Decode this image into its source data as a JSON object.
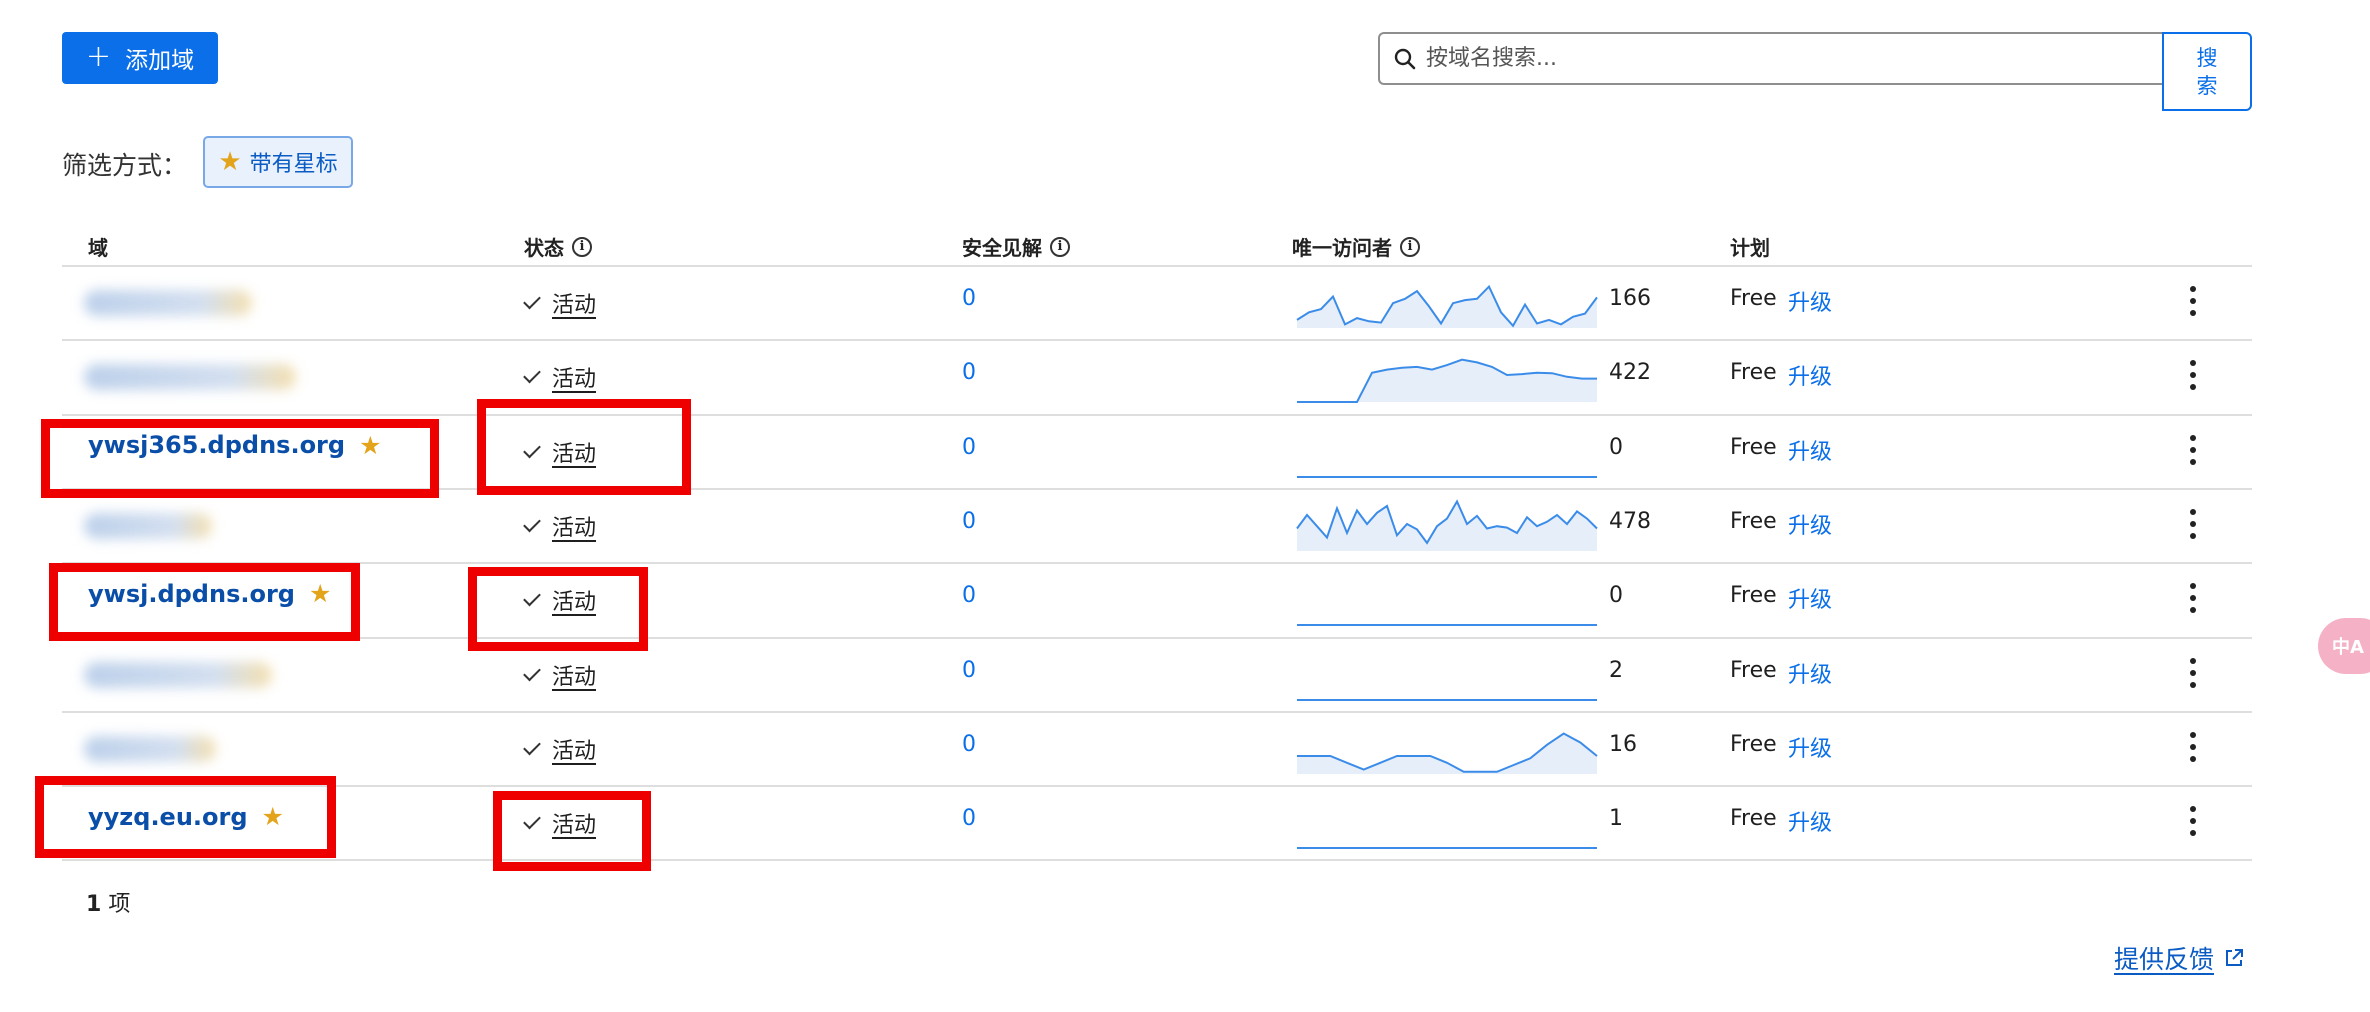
{
  "toolbar": {
    "add_plus": "+",
    "add_label": "添加域",
    "search_placeholder": "按域名搜索...",
    "search_button": "搜\n索"
  },
  "filter": {
    "label": "筛选方式：",
    "chip_label": "带有星标",
    "chip_icon": "star-icon"
  },
  "table": {
    "headers": {
      "domain": "域",
      "status": "状态",
      "insights": "安全见解",
      "visitors": "唯一访问者",
      "plan": "计划"
    },
    "rows": [
      {
        "domain": "",
        "blurred": true,
        "status": "活动",
        "insights": "0",
        "visitors": "166",
        "plan": "Free",
        "upgrade": "升级",
        "spark": [
          0.18,
          0.35,
          0.42,
          0.7,
          0.08,
          0.22,
          0.15,
          0.12,
          0.55,
          0.65,
          0.82,
          0.48,
          0.1,
          0.55,
          0.62,
          0.65,
          0.92,
          0.35,
          0.05,
          0.52,
          0.1,
          0.18,
          0.08,
          0.25,
          0.32,
          0.68
        ]
      },
      {
        "domain": "",
        "blurred": true,
        "status": "活动",
        "insights": "0",
        "visitors": "422",
        "plan": "Free",
        "upgrade": "升级",
        "spark": [
          0.0,
          0.0,
          0.0,
          0.0,
          0.0,
          0.65,
          0.72,
          0.76,
          0.78,
          0.72,
          0.82,
          0.94,
          0.88,
          0.78,
          0.6,
          0.62,
          0.65,
          0.64,
          0.56,
          0.52,
          0.52
        ]
      },
      {
        "domain": "ywsj365.dpdns.org",
        "blurred": false,
        "status": "活动",
        "insights": "0",
        "visitors": "0",
        "plan": "Free",
        "upgrade": "升级",
        "spark": [
          0,
          0
        ]
      },
      {
        "domain": "",
        "blurred": true,
        "status": "活动",
        "insights": "0",
        "visitors": "478",
        "plan": "Free",
        "upgrade": "升级",
        "spark": [
          0.5,
          0.8,
          0.55,
          0.3,
          0.95,
          0.4,
          0.9,
          0.6,
          0.85,
          1.0,
          0.35,
          0.6,
          0.48,
          0.18,
          0.55,
          0.72,
          1.1,
          0.6,
          0.78,
          0.5,
          0.55,
          0.52,
          0.4,
          0.75,
          0.55,
          0.65,
          0.8,
          0.6,
          0.88,
          0.72,
          0.5
        ]
      },
      {
        "domain": "ywsj.dpdns.org",
        "blurred": false,
        "status": "活动",
        "insights": "0",
        "visitors": "0",
        "plan": "Free",
        "upgrade": "升级",
        "spark": [
          0,
          0
        ]
      },
      {
        "domain": "",
        "blurred": true,
        "status": "活动",
        "insights": "0",
        "visitors": "2",
        "plan": "Free",
        "upgrade": "升级",
        "spark": [
          0,
          0
        ]
      },
      {
        "domain": "",
        "blurred": true,
        "status": "活动",
        "insights": "0",
        "visitors": "16",
        "plan": "Free",
        "upgrade": "升级",
        "spark": [
          0.4,
          0.4,
          0.4,
          0.25,
          0.1,
          0.25,
          0.4,
          0.4,
          0.4,
          0.25,
          0.05,
          0.05,
          0.05,
          0.2,
          0.35,
          0.65,
          0.9,
          0.7,
          0.4
        ]
      },
      {
        "domain": "yyzq.eu.org",
        "blurred": false,
        "status": "活动",
        "insights": "0",
        "visitors": "1",
        "plan": "Free",
        "upgrade": "升级",
        "spark": [
          0,
          0
        ]
      }
    ]
  },
  "footer": {
    "count_number": "1",
    "count_unit": "项",
    "feedback": "提供反馈"
  },
  "translate_fab": "中A",
  "colors": {
    "accent": "#0a6fe8",
    "star": "#e3a31b",
    "highlight": "#ee0000"
  }
}
